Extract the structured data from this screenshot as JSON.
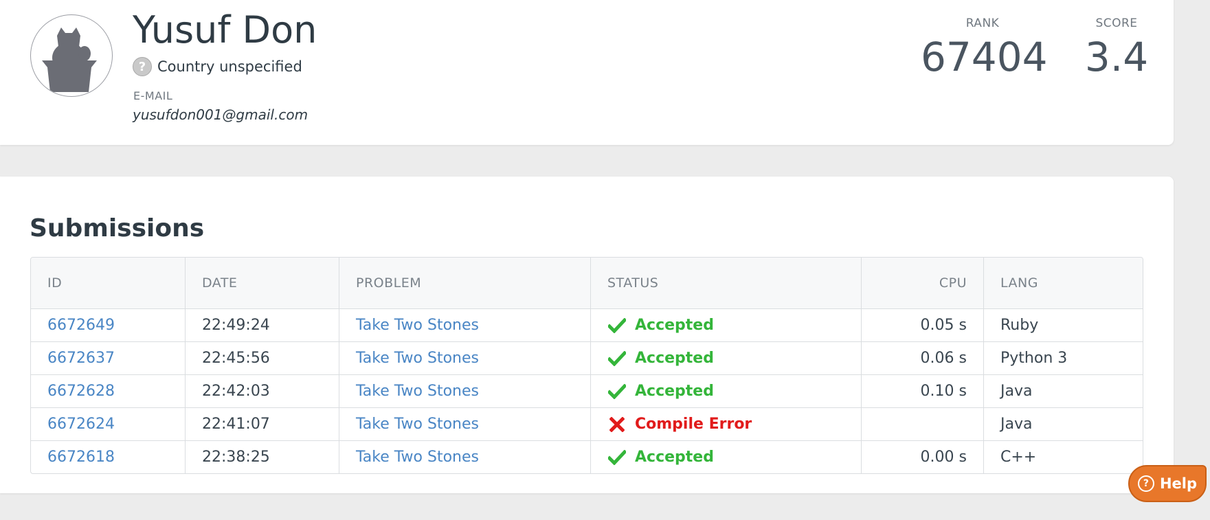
{
  "profile": {
    "name": "Yusuf Don",
    "country": "Country unspecified",
    "country_icon": "question-icon",
    "email_label": "E-MAIL",
    "email": "yusufdon001@gmail.com",
    "avatar_icon": "cat-avatar-icon",
    "rank_label": "RANK",
    "rank_value": "67404",
    "score_label": "SCORE",
    "score_value": "3.4"
  },
  "submissions": {
    "title": "Submissions",
    "columns": {
      "id": "ID",
      "date": "DATE",
      "problem": "PROBLEM",
      "status": "STATUS",
      "cpu": "CPU",
      "lang": "LANG"
    },
    "rows": [
      {
        "id": "6672649",
        "date": "22:49:24",
        "problem": "Take Two Stones",
        "status": "Accepted",
        "cpu": "0.05 s",
        "lang": "Ruby"
      },
      {
        "id": "6672637",
        "date": "22:45:56",
        "problem": "Take Two Stones",
        "status": "Accepted",
        "cpu": "0.06 s",
        "lang": "Python 3"
      },
      {
        "id": "6672628",
        "date": "22:42:03",
        "problem": "Take Two Stones",
        "status": "Accepted",
        "cpu": "0.10 s",
        "lang": "Java"
      },
      {
        "id": "6672624",
        "date": "22:41:07",
        "problem": "Take Two Stones",
        "status": "Compile Error",
        "cpu": "",
        "lang": "Java"
      },
      {
        "id": "6672618",
        "date": "22:38:25",
        "problem": "Take Two Stones",
        "status": "Accepted",
        "cpu": "0.00 s",
        "lang": "C++"
      }
    ]
  },
  "help": {
    "label": "Help",
    "icon": "question-circle-icon"
  },
  "colors": {
    "accepted": "#34b53a",
    "error": "#e11b1b",
    "link": "#4a86c5",
    "help": "#e8772a"
  }
}
